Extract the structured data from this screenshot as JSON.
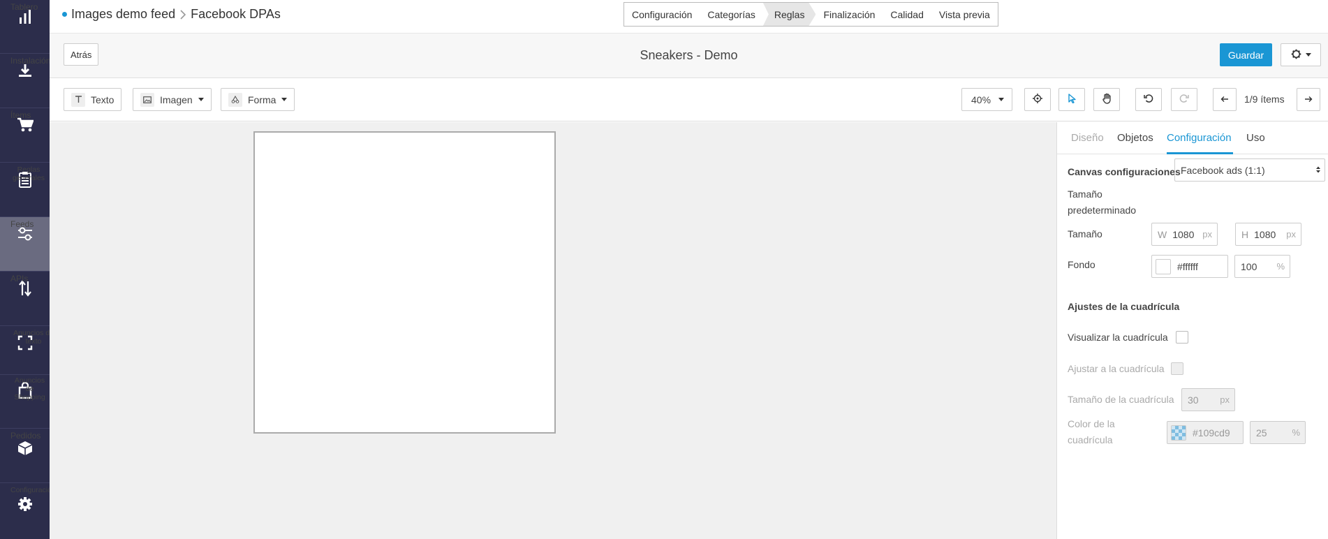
{
  "sidebar": {
    "items": [
      {
        "label": "Tablero",
        "icon": "bar-chart-icon"
      },
      {
        "label": "Instalación",
        "icon": "download-icon"
      },
      {
        "label": "Ítems",
        "icon": "cart-icon"
      },
      {
        "label": "Reglas generales",
        "icon": "clipboard-icon"
      },
      {
        "label": "Feeds",
        "icon": "sliders-icon",
        "active": true
      },
      {
        "label": "APIs",
        "icon": "swap-vertical-icon"
      },
      {
        "label": "Anuncios de texto",
        "icon": "expand-icon"
      },
      {
        "label": "Anuncios de Shopping",
        "icon": "shopping-bag-icon"
      },
      {
        "label": "Pedidos",
        "icon": "box-icon"
      },
      {
        "label": "Configuración",
        "icon": "gear-icon"
      }
    ]
  },
  "breadcrumb": {
    "feed": "Images demo feed",
    "channel": "Facebook DPAs"
  },
  "steps": [
    "Configuración",
    "Categorías",
    "Reglas",
    "Finalización",
    "Calidad",
    "Vista previa"
  ],
  "header": {
    "back_label": "Atrás",
    "title": "Sneakers - Demo",
    "save_label": "Guardar"
  },
  "toolbar": {
    "text_label": "Texto",
    "image_label": "Imagen",
    "shape_label": "Forma",
    "zoom": "40%",
    "pager": "1/9 ítems"
  },
  "panel": {
    "tabs": [
      "Diseño",
      "Objetos",
      "Configuración",
      "Uso"
    ],
    "canvas_section": "Canvas configuraciones",
    "default_size_label": "Tamaño predeterminado",
    "default_size_value": "Facebook ads (1:1)",
    "size_label": "Tamaño",
    "width_prefix": "W",
    "width_value": "1080",
    "height_prefix": "H",
    "height_value": "1080",
    "px": "px",
    "background_label": "Fondo",
    "background_color": "#ffffff",
    "background_opacity": "100",
    "percent": "%",
    "grid_section": "Ajustes de la cuadrícula",
    "show_grid_label": "Visualizar la cuadrícula",
    "snap_grid_label": "Ajustar a la cuadrícula",
    "grid_size_label": "Tamaño de la cuadrícula",
    "grid_size_value": "30",
    "grid_color_label": "Color de la cuadrícula",
    "grid_color_value": "#109cd9",
    "grid_opacity": "25"
  },
  "colors": {
    "sidebar": "#2c2d4b",
    "accent": "#1a96d4"
  }
}
